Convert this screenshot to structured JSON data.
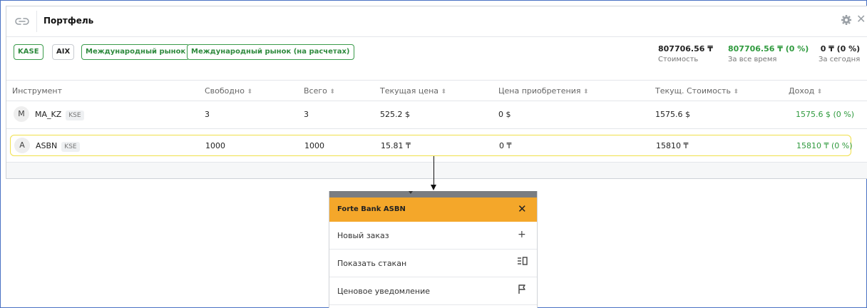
{
  "window": {
    "title": "Портфель"
  },
  "filters": [
    "KASE",
    "AIX",
    "Международный рынок",
    "Международный рынок (на расчетах)"
  ],
  "summary": [
    {
      "value": "807706.56 ₸",
      "label": "Стоимость"
    },
    {
      "value": "807706.56 ₸ (0 %)",
      "label": "За все время"
    },
    {
      "value": "0 ₸ (0 %)",
      "label": "За сегодня"
    }
  ],
  "table": {
    "columns": [
      "Инструмент",
      "Свободно",
      "Всего",
      "Текущая цена",
      "Цена приобретения",
      "Текущ. Стоимость",
      "Доход"
    ],
    "rows": [
      {
        "avatar": "M",
        "ticker": "MA_KZ",
        "exchange": "KSE",
        "free": "3",
        "total": "3",
        "price": "525.2 $",
        "purchase": "0 $",
        "value": "1575.6 $",
        "income": "1575.6 $ (0 %)"
      },
      {
        "avatar": "A",
        "ticker": "ASBN",
        "exchange": "KSE",
        "free": "1000",
        "total": "1000",
        "price": "15.81 ₸",
        "purchase": "0 ₸",
        "value": "15810 ₸",
        "income": "15810 ₸ (0 %)"
      }
    ]
  },
  "context_menu": {
    "title": "Forte Bank ASBN",
    "items": [
      {
        "label": "Новый заказ",
        "icon": "plus-icon"
      },
      {
        "label": "Показать стакан",
        "icon": "orderbook-icon"
      },
      {
        "label": "Ценовое уведомление",
        "icon": "flag-icon"
      }
    ]
  },
  "colors": {
    "accent_green": "#2f9a3e",
    "menu_header": "#f4a72a",
    "selection": "#f0e04a"
  }
}
